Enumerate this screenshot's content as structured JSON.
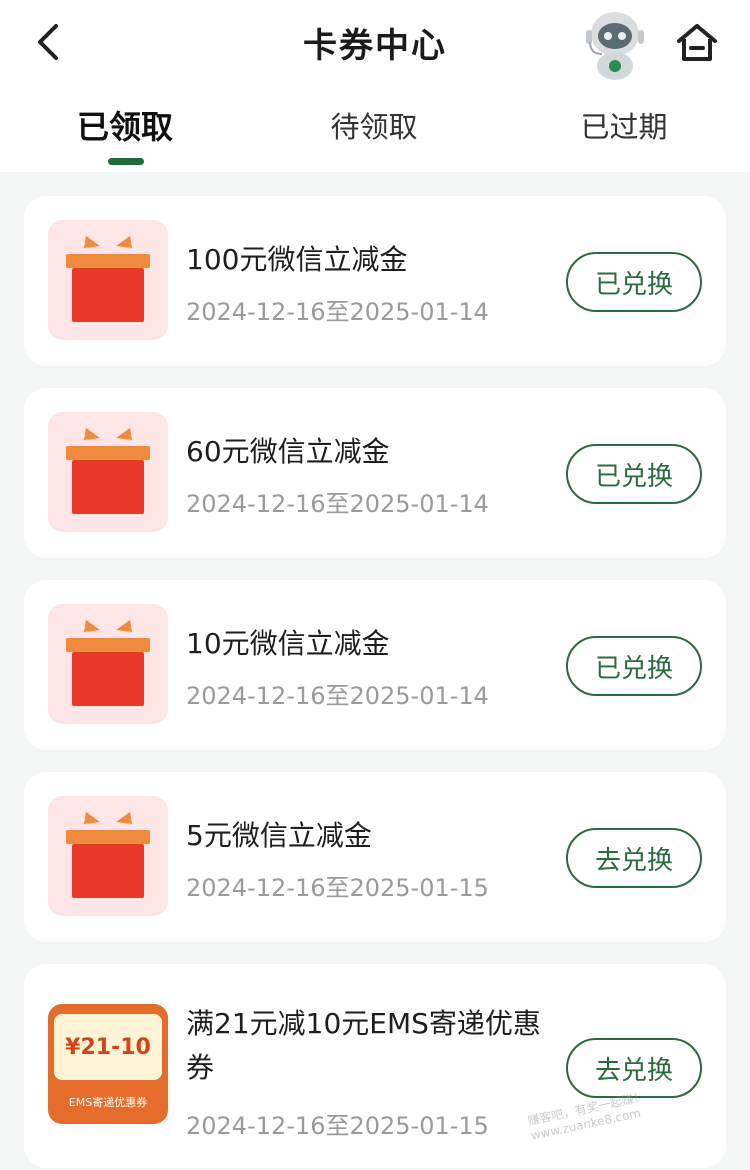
{
  "header": {
    "title": "卡券中心",
    "back_icon": "chevron-left-icon",
    "assistant_icon": "robot-avatar-icon",
    "home_icon": "home-icon"
  },
  "tabs": [
    {
      "label": "已领取",
      "active": true
    },
    {
      "label": "待领取",
      "active": false
    },
    {
      "label": "已过期",
      "active": false
    }
  ],
  "colors": {
    "accent": "#1f6b3a",
    "gift_red": "#e8382c",
    "gift_orange": "#f08a3c",
    "thumb_bg": "#fde6e5"
  },
  "coupons": [
    {
      "title": "100元微信立减金",
      "date": "2024-12-16至2025-01-14",
      "action": "已兑换",
      "icon": "gift-box-icon"
    },
    {
      "title": "60元微信立减金",
      "date": "2024-12-16至2025-01-14",
      "action": "已兑换",
      "icon": "gift-box-icon"
    },
    {
      "title": "10元微信立减金",
      "date": "2024-12-16至2025-01-14",
      "action": "已兑换",
      "icon": "gift-box-icon"
    },
    {
      "title": "5元微信立减金",
      "date": "2024-12-16至2025-01-15",
      "action": "去兑换",
      "icon": "gift-box-icon"
    },
    {
      "title": "满21元减10元EMS寄递优惠券",
      "date": "2024-12-16至2025-01-15",
      "action": "去兑换",
      "icon": "ems-coupon-icon",
      "badge_amount": "¥21-10",
      "badge_text": "EMS寄递优惠券"
    }
  ],
  "watermark": "赚客吧，有奖一起赚！ www.zuanke8.com"
}
